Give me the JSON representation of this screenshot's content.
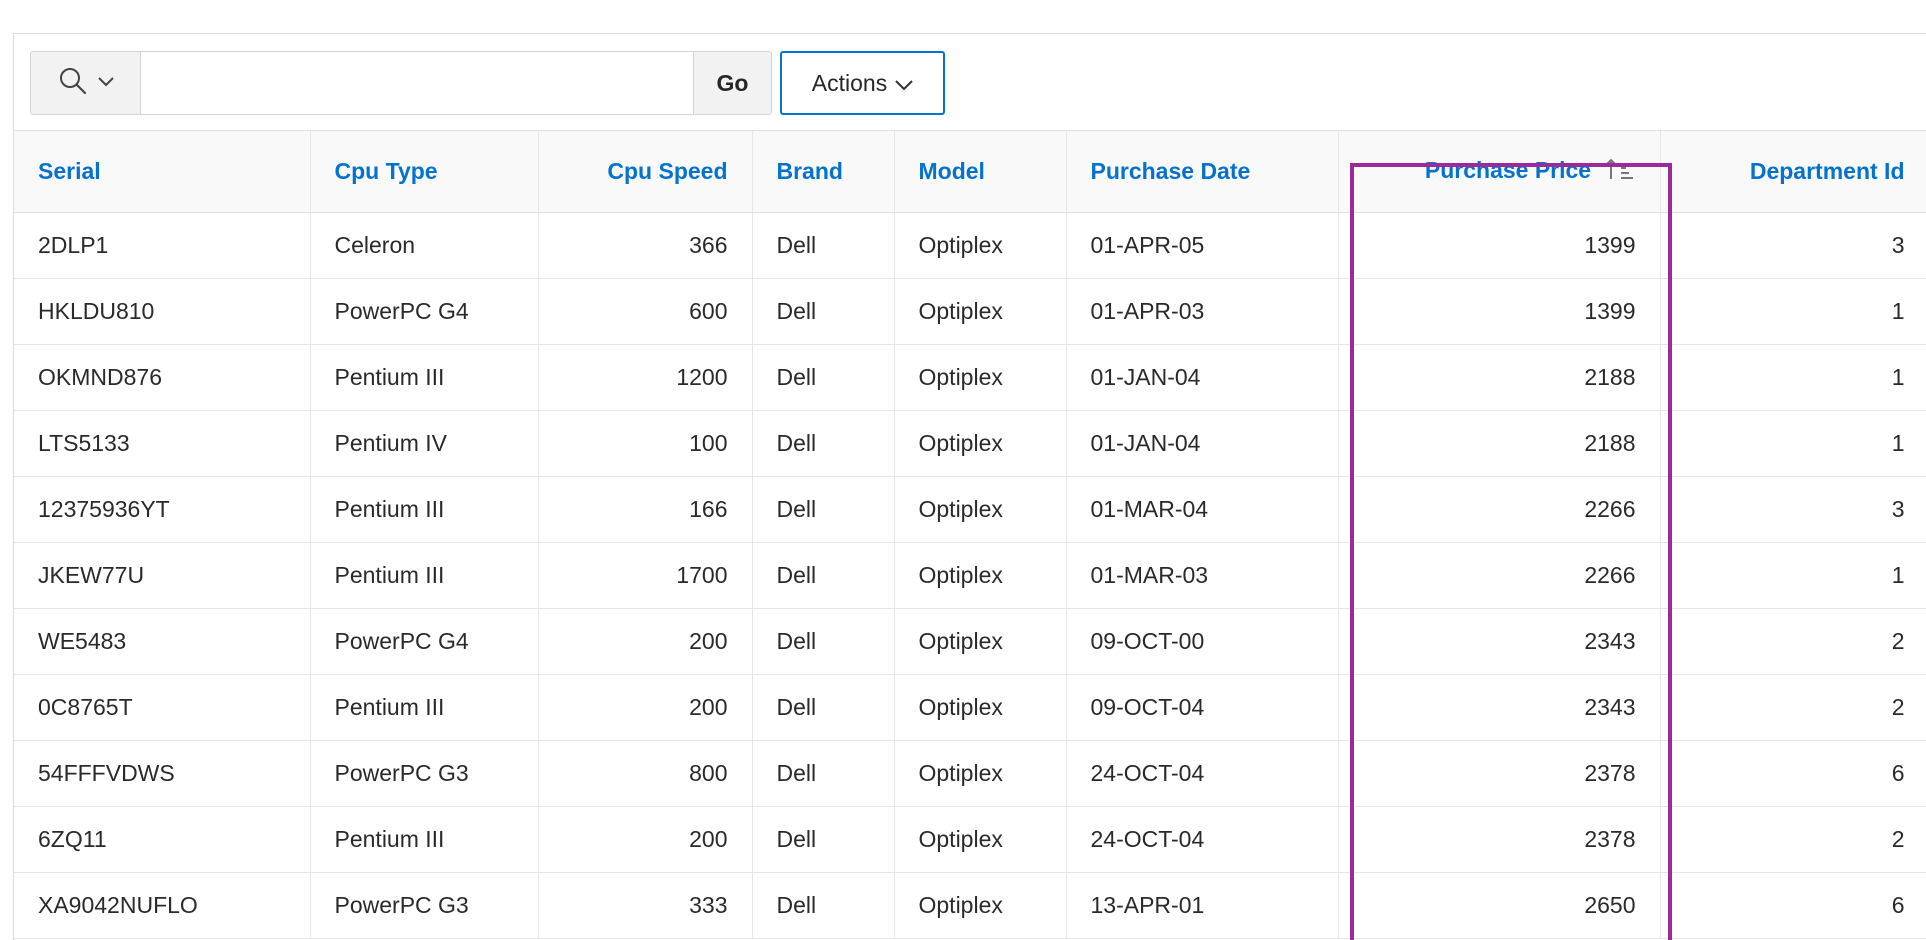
{
  "toolbar": {
    "search_placeholder": "",
    "search_value": "",
    "go_label": "Go",
    "actions_label": "Actions"
  },
  "icons": {
    "search": "search-icon",
    "chevron": "chevron-down-icon",
    "sort": "sort-ascending-icon"
  },
  "colors": {
    "header_link": "#0572ce",
    "highlight": "#9b2b9b"
  },
  "table": {
    "columns": [
      "Serial",
      "Cpu Type",
      "Cpu Speed",
      "Brand",
      "Model",
      "Purchase Date",
      "Purchase Price",
      "Department Id"
    ],
    "sorted_column": "Purchase Price",
    "sort_direction": "ascending",
    "rows": [
      [
        "2DLP1",
        "Celeron",
        "366",
        "Dell",
        "Optiplex",
        "01-APR-05",
        "1399",
        "3"
      ],
      [
        "HKLDU810",
        "PowerPC G4",
        "600",
        "Dell",
        "Optiplex",
        "01-APR-03",
        "1399",
        "1"
      ],
      [
        "OKMND876",
        "Pentium III",
        "1200",
        "Dell",
        "Optiplex",
        "01-JAN-04",
        "2188",
        "1"
      ],
      [
        "LTS5133",
        "Pentium IV",
        "100",
        "Dell",
        "Optiplex",
        "01-JAN-04",
        "2188",
        "1"
      ],
      [
        "12375936YT",
        "Pentium III",
        "166",
        "Dell",
        "Optiplex",
        "01-MAR-04",
        "2266",
        "3"
      ],
      [
        "JKEW77U",
        "Pentium III",
        "1700",
        "Dell",
        "Optiplex",
        "01-MAR-03",
        "2266",
        "1"
      ],
      [
        "WE5483",
        "PowerPC G4",
        "200",
        "Dell",
        "Optiplex",
        "09-OCT-00",
        "2343",
        "2"
      ],
      [
        "0C8765T",
        "Pentium III",
        "200",
        "Dell",
        "Optiplex",
        "09-OCT-04",
        "2343",
        "2"
      ],
      [
        "54FFFVDWS",
        "PowerPC G3",
        "800",
        "Dell",
        "Optiplex",
        "24-OCT-04",
        "2378",
        "6"
      ],
      [
        "6ZQ11",
        "Pentium III",
        "200",
        "Dell",
        "Optiplex",
        "24-OCT-04",
        "2378",
        "2"
      ],
      [
        "XA9042NUFLO",
        "PowerPC G3",
        "333",
        "Dell",
        "Optiplex",
        "13-APR-01",
        "2650",
        "6"
      ]
    ]
  }
}
